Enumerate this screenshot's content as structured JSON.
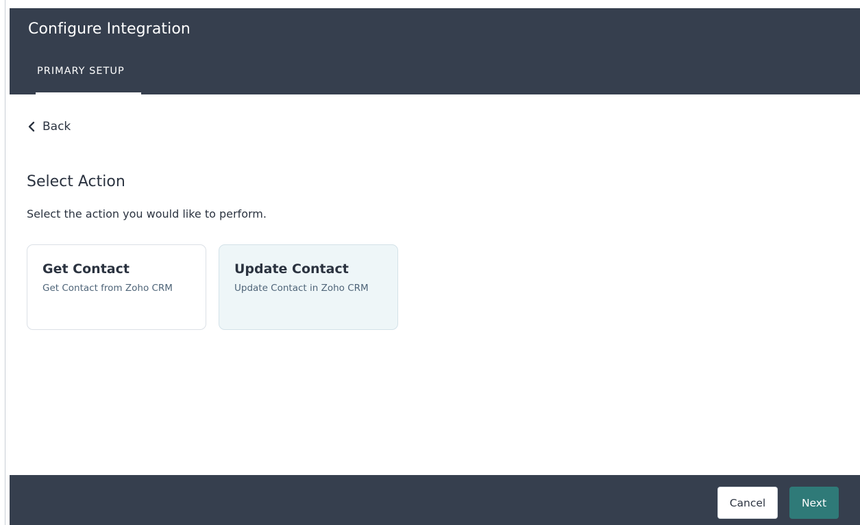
{
  "header": {
    "title": "Configure Integration",
    "tabs": [
      {
        "label": "PRIMARY SETUP",
        "active": true
      }
    ]
  },
  "nav": {
    "back_label": "Back",
    "back_icon": "chevron-left-icon"
  },
  "main": {
    "heading": "Select Action",
    "description": "Select the action you would like to perform.",
    "actions": [
      {
        "title": "Get Contact",
        "subtitle": "Get Contact from Zoho CRM",
        "selected": false
      },
      {
        "title": "Update Contact",
        "subtitle": "Update Contact in Zoho CRM",
        "selected": true
      }
    ]
  },
  "footer": {
    "cancel_label": "Cancel",
    "next_label": "Next"
  },
  "colors": {
    "header_bg": "#363f4e",
    "primary_button": "#2f7a78",
    "selected_card_bg": "#eef6f8",
    "text": "#2b3340"
  }
}
